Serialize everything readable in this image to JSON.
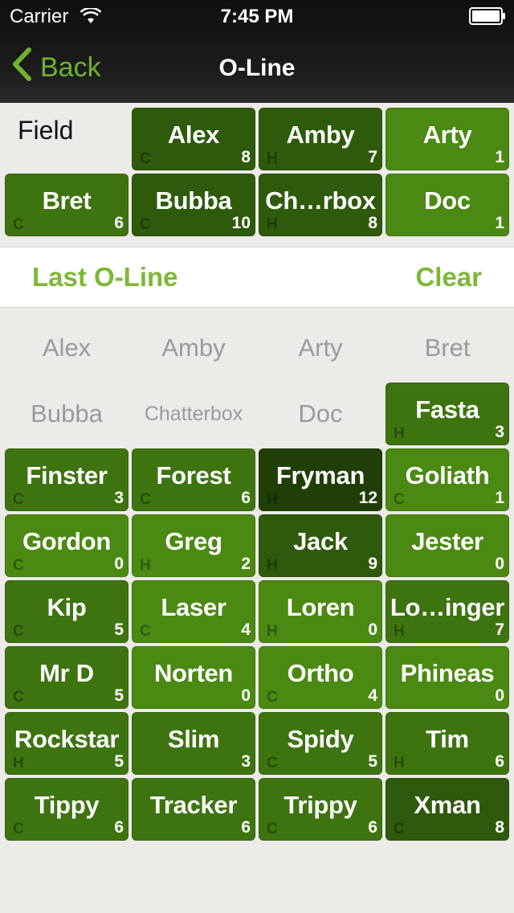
{
  "status": {
    "carrier": "Carrier",
    "time": "7:45 PM"
  },
  "nav": {
    "back": "Back",
    "title": "O-Line"
  },
  "field_label": "Field",
  "field": [
    {
      "name": "Alex",
      "count": "8",
      "pos": "C",
      "color": "#2e5b0b"
    },
    {
      "name": "Amby",
      "count": "7",
      "pos": "H",
      "color": "#2e5b0b"
    },
    {
      "name": "Arty",
      "count": "1",
      "pos": "",
      "color": "#4b8a12"
    },
    {
      "name": "Bret",
      "count": "6",
      "pos": "C",
      "color": "#3d7410"
    },
    {
      "name": "Bubba",
      "count": "10",
      "pos": "C",
      "color": "#2e5b0b"
    },
    {
      "name": "Ch…rbox",
      "count": "8",
      "pos": "H",
      "color": "#2e5b0b"
    },
    {
      "name": "Doc",
      "count": "1",
      "pos": "",
      "color": "#4b8a12"
    }
  ],
  "actions": {
    "last": "Last O-Line",
    "clear": "Clear"
  },
  "bench_empty": [
    "Alex",
    "Amby",
    "Arty",
    "Bret",
    "Bubba",
    "Chatterbox",
    "Doc"
  ],
  "bench": [
    {
      "name": "Fasta",
      "count": "3",
      "pos": "H",
      "color": "#3d7410"
    },
    {
      "name": "Finster",
      "count": "3",
      "pos": "C",
      "color": "#3d7410"
    },
    {
      "name": "Forest",
      "count": "6",
      "pos": "C",
      "color": "#3d7410"
    },
    {
      "name": "Fryman",
      "count": "12",
      "pos": "H",
      "color": "#1f3f07"
    },
    {
      "name": "Goliath",
      "count": "1",
      "pos": "C",
      "color": "#4b8a12"
    },
    {
      "name": "Gordon",
      "count": "0",
      "pos": "C",
      "color": "#4b8a12"
    },
    {
      "name": "Greg",
      "count": "2",
      "pos": "H",
      "color": "#4b8a12"
    },
    {
      "name": "Jack",
      "count": "9",
      "pos": "H",
      "color": "#2e5b0b"
    },
    {
      "name": "Jester",
      "count": "0",
      "pos": "",
      "color": "#4b8a12"
    },
    {
      "name": "Kip",
      "count": "5",
      "pos": "C",
      "color": "#3d7410"
    },
    {
      "name": "Laser",
      "count": "4",
      "pos": "C",
      "color": "#4b8a12"
    },
    {
      "name": "Loren",
      "count": "0",
      "pos": "H",
      "color": "#4b8a12"
    },
    {
      "name": "Lo…inger",
      "count": "7",
      "pos": "H",
      "color": "#3d7410"
    },
    {
      "name": "Mr D",
      "count": "5",
      "pos": "C",
      "color": "#3d7410"
    },
    {
      "name": "Norten",
      "count": "0",
      "pos": "",
      "color": "#4b8a12"
    },
    {
      "name": "Ortho",
      "count": "4",
      "pos": "C",
      "color": "#4b8a12"
    },
    {
      "name": "Phineas",
      "count": "0",
      "pos": "",
      "color": "#4b8a12"
    },
    {
      "name": "Rockstar",
      "count": "5",
      "pos": "H",
      "color": "#3d7410"
    },
    {
      "name": "Slim",
      "count": "3",
      "pos": "",
      "color": "#3d7410"
    },
    {
      "name": "Spidy",
      "count": "5",
      "pos": "C",
      "color": "#3d7410"
    },
    {
      "name": "Tim",
      "count": "6",
      "pos": "H",
      "color": "#3d7410"
    },
    {
      "name": "Tippy",
      "count": "6",
      "pos": "C",
      "color": "#3d7410"
    },
    {
      "name": "Tracker",
      "count": "6",
      "pos": "",
      "color": "#3d7410"
    },
    {
      "name": "Trippy",
      "count": "6",
      "pos": "C",
      "color": "#3d7410"
    },
    {
      "name": "Xman",
      "count": "8",
      "pos": "C",
      "color": "#2e5b0b"
    }
  ]
}
